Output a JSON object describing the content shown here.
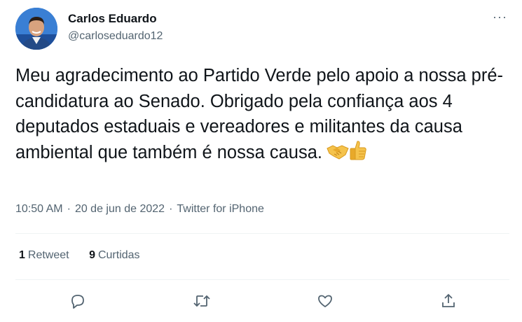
{
  "author": {
    "name": "Carlos Eduardo",
    "handle": "@carloseduardo12"
  },
  "tweet": {
    "text": "Meu agradecimento ao Partido Verde pelo apoio a nossa pré-candidatura ao Senado. Obrigado pela confiança aos 4 deputados estaduais e vereadores e militantes da causa ambiental que também é nossa causa.",
    "emojis": [
      "handshake-emoji",
      "thumbs-up-emoji"
    ]
  },
  "meta": {
    "time": "10:50 AM",
    "date": "20 de jun de 2022",
    "source": "Twitter for iPhone",
    "separator": "·"
  },
  "stats": {
    "retweets_count": "1",
    "retweets_label": "Retweet",
    "likes_count": "9",
    "likes_label": "Curtidas"
  },
  "menu": {
    "more_label": "···"
  },
  "actions": [
    {
      "name": "reply",
      "icon": "reply-icon"
    },
    {
      "name": "retweet",
      "icon": "retweet-icon"
    },
    {
      "name": "like",
      "icon": "heart-icon"
    },
    {
      "name": "share",
      "icon": "share-icon"
    }
  ],
  "colors": {
    "text": "#0f1419",
    "secondary": "#536471",
    "divider": "#eff3f4",
    "avatar_bg": "#2f73c9"
  }
}
